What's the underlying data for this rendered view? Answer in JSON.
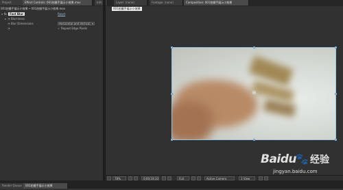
{
  "left_tabs": [
    "Project",
    "Effect Controls: 001拍摄手展示小效果.mov",
    "Info"
  ],
  "breadcrumb": "001拍摄手展示小效果 • 001拍摄手展示小效果.mov",
  "effect": {
    "reset_label": "Reset",
    "name": "Fast Blur",
    "rows": [
      {
        "label": "Blurriness",
        "value": ""
      },
      {
        "label": "Blur Dimensions",
        "value": "Horizontal and Vertical"
      },
      {
        "label": "",
        "value": "Repeat Edge Pixels"
      }
    ]
  },
  "right_tabs": [
    "Layer: (none)",
    "Footage: (none)",
    "Composition: 001拍摄手展示小效果"
  ],
  "comp_tab": "001拍摄手展示小效果",
  "status_bar": {
    "zoom": "78%",
    "timecode": "0;00;19;10",
    "resolution": "Full",
    "camera": "Active Camera",
    "views": "1 View"
  },
  "bottom_tabs": [
    "Render Queue",
    "001拍摄手展示小效果"
  ],
  "watermark": {
    "brand": "Baidu",
    "cn": "经验",
    "url": "jingyan.baidu.com"
  }
}
